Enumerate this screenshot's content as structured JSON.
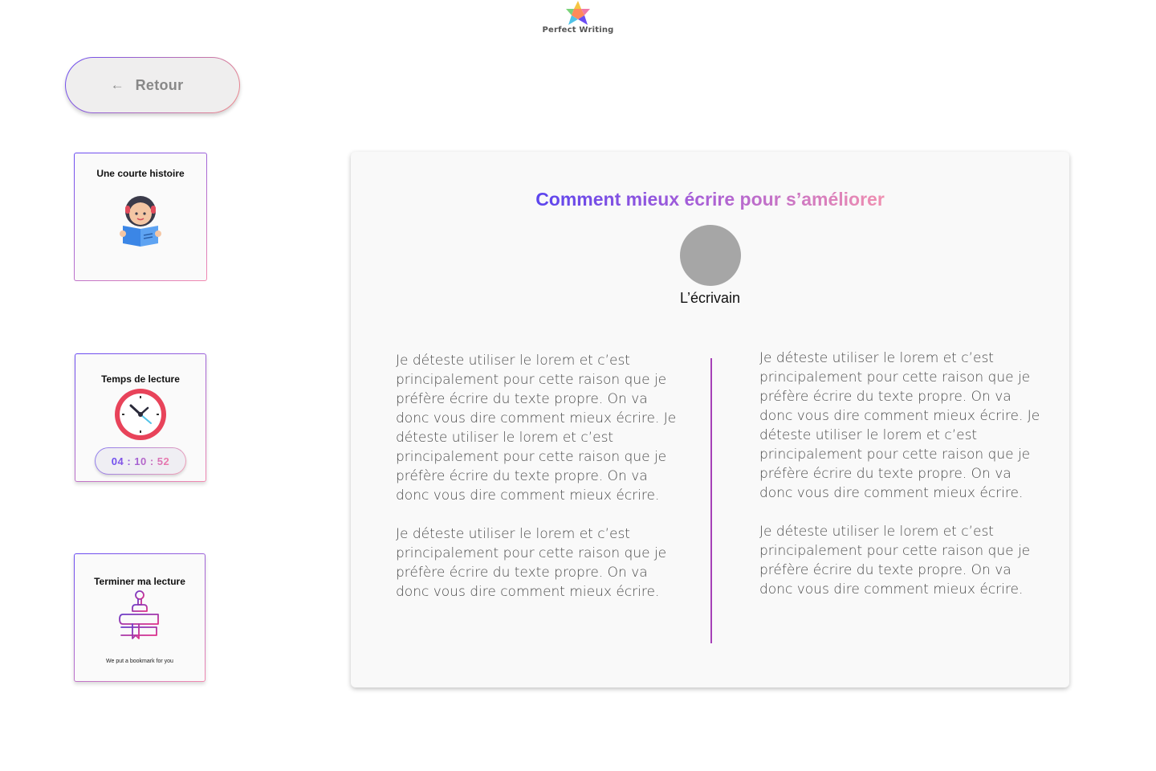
{
  "logo": {
    "text": "Perfect Writing"
  },
  "back_button": {
    "label": "Retour",
    "icon": "arrow-left-icon"
  },
  "sidebar": {
    "story_card": {
      "title": "Une courte histoire",
      "icon": "reading-girl-icon"
    },
    "time_card": {
      "title": "Temps de lecture",
      "icon": "clock-icon",
      "timer": "04 : 10 : 52"
    },
    "finish_card": {
      "title": "Terminer ma lecture",
      "icon": "stamp-books-icon",
      "note": "We put a bookmark for you"
    }
  },
  "article": {
    "title": "Comment mieux écrire pour s’améliorer",
    "author": "L’écrivain",
    "left_column": [
      "Je déteste utiliser le lorem et c’est principalement pour cette raison que je préfère écrire du texte propre. On va donc vous dire comment mieux écrire. Je déteste utiliser le lorem et c’est principalement pour cette raison que je préfère écrire du texte propre. On va donc vous dire comment mieux écrire.",
      "Je déteste utiliser le lorem et c’est principalement pour cette raison que je préfère écrire du texte propre. On va donc vous dire comment mieux écrire."
    ],
    "right_column": [
      "Je déteste utiliser le lorem et c’est principalement pour cette raison que je préfère écrire du texte propre. On va donc vous dire comment mieux écrire. Je déteste utiliser le lorem et c’est principalement pour cette raison que je préfère écrire du texte propre. On va donc vous dire comment mieux écrire.",
      "Je déteste utiliser le lorem et c’est principalement pour cette raison que je préfère écrire du texte propre. On va donc vous dire comment mieux écrire."
    ]
  },
  "colors": {
    "gradient_start": "#6a4cf3",
    "gradient_end": "#f28ab0",
    "divider": "#a640b8"
  }
}
